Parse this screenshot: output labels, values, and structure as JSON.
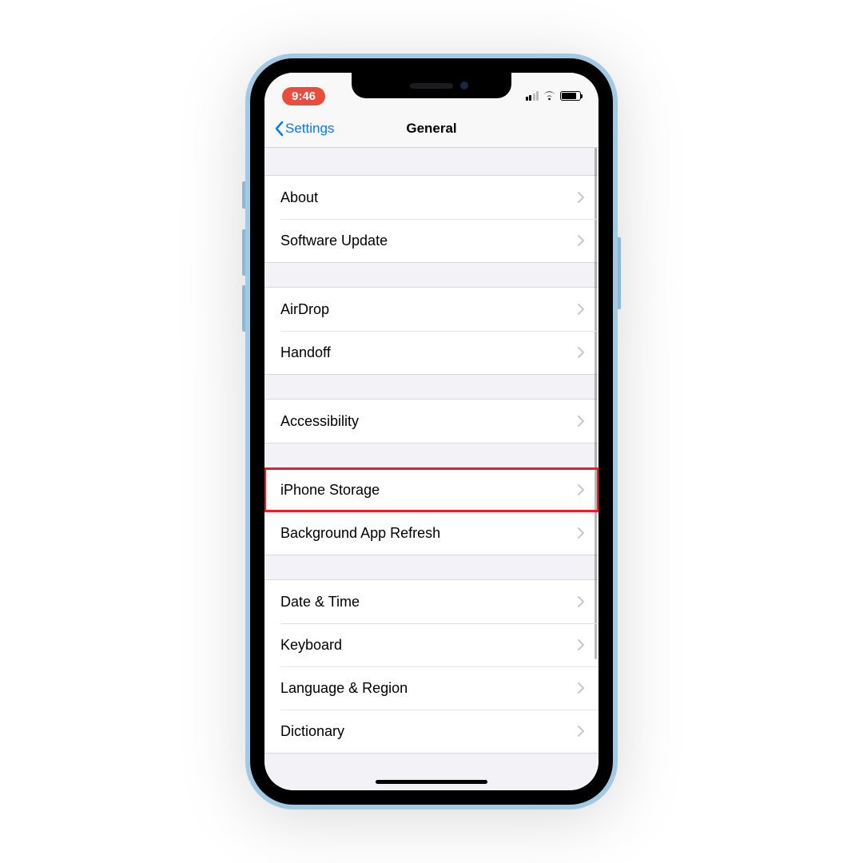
{
  "status": {
    "time": "9:46"
  },
  "nav": {
    "back_label": "Settings",
    "title": "General"
  },
  "groups": [
    {
      "items": [
        {
          "label": "About",
          "highlight": false
        },
        {
          "label": "Software Update",
          "highlight": false
        }
      ]
    },
    {
      "items": [
        {
          "label": "AirDrop",
          "highlight": false
        },
        {
          "label": "Handoff",
          "highlight": false
        }
      ]
    },
    {
      "items": [
        {
          "label": "Accessibility",
          "highlight": false
        }
      ]
    },
    {
      "items": [
        {
          "label": "iPhone Storage",
          "highlight": true
        },
        {
          "label": "Background App Refresh",
          "highlight": false
        }
      ]
    },
    {
      "items": [
        {
          "label": "Date & Time",
          "highlight": false
        },
        {
          "label": "Keyboard",
          "highlight": false
        },
        {
          "label": "Language & Region",
          "highlight": false
        },
        {
          "label": "Dictionary",
          "highlight": false
        }
      ]
    }
  ]
}
